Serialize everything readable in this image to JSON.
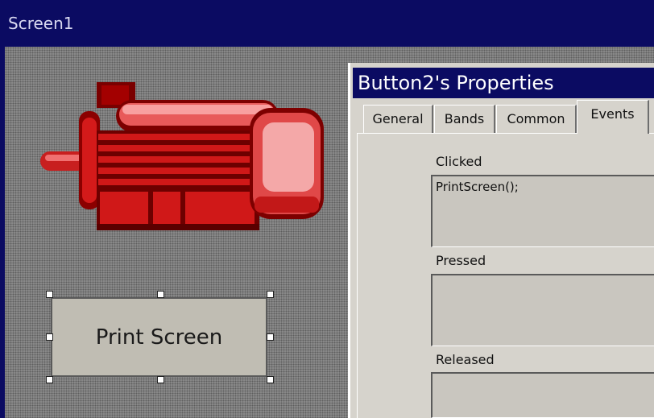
{
  "screen": {
    "title": "Screen1"
  },
  "canvas": {
    "motor_image": "electric-motor-graphic",
    "print_button": {
      "label": "Print Screen",
      "selected": true
    }
  },
  "properties": {
    "title": "Button2's Properties",
    "tabs": [
      {
        "label": "General",
        "active": false
      },
      {
        "label": "Bands",
        "active": false
      },
      {
        "label": "Common",
        "active": false
      },
      {
        "label": "Events",
        "active": true
      }
    ],
    "events": {
      "clicked": {
        "label": "Clicked",
        "value": "PrintScreen();"
      },
      "pressed": {
        "label": "Pressed",
        "value": ""
      },
      "released": {
        "label": "Released",
        "value": ""
      }
    }
  },
  "colors": {
    "title_bar": "#0b0b62",
    "dialog_bg": "#d6d3cc",
    "motor_red": "#d0141e"
  }
}
